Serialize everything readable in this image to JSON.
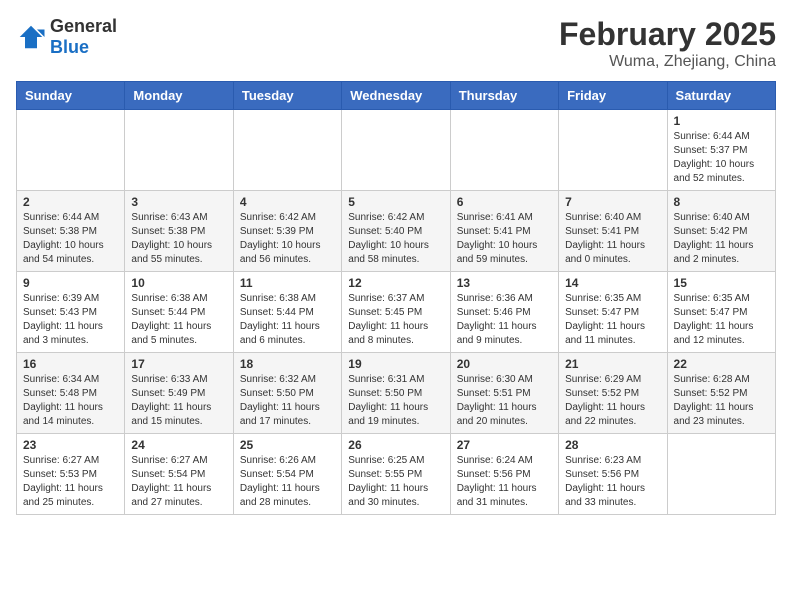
{
  "header": {
    "logo_general": "General",
    "logo_blue": "Blue",
    "title": "February 2025",
    "subtitle": "Wuma, Zhejiang, China"
  },
  "weekdays": [
    "Sunday",
    "Monday",
    "Tuesday",
    "Wednesday",
    "Thursday",
    "Friday",
    "Saturday"
  ],
  "weeks": [
    [
      {
        "day": "",
        "info": ""
      },
      {
        "day": "",
        "info": ""
      },
      {
        "day": "",
        "info": ""
      },
      {
        "day": "",
        "info": ""
      },
      {
        "day": "",
        "info": ""
      },
      {
        "day": "",
        "info": ""
      },
      {
        "day": "1",
        "info": "Sunrise: 6:44 AM\nSunset: 5:37 PM\nDaylight: 10 hours\nand 52 minutes."
      }
    ],
    [
      {
        "day": "2",
        "info": "Sunrise: 6:44 AM\nSunset: 5:38 PM\nDaylight: 10 hours\nand 54 minutes."
      },
      {
        "day": "3",
        "info": "Sunrise: 6:43 AM\nSunset: 5:38 PM\nDaylight: 10 hours\nand 55 minutes."
      },
      {
        "day": "4",
        "info": "Sunrise: 6:42 AM\nSunset: 5:39 PM\nDaylight: 10 hours\nand 56 minutes."
      },
      {
        "day": "5",
        "info": "Sunrise: 6:42 AM\nSunset: 5:40 PM\nDaylight: 10 hours\nand 58 minutes."
      },
      {
        "day": "6",
        "info": "Sunrise: 6:41 AM\nSunset: 5:41 PM\nDaylight: 10 hours\nand 59 minutes."
      },
      {
        "day": "7",
        "info": "Sunrise: 6:40 AM\nSunset: 5:41 PM\nDaylight: 11 hours\nand 0 minutes."
      },
      {
        "day": "8",
        "info": "Sunrise: 6:40 AM\nSunset: 5:42 PM\nDaylight: 11 hours\nand 2 minutes."
      }
    ],
    [
      {
        "day": "9",
        "info": "Sunrise: 6:39 AM\nSunset: 5:43 PM\nDaylight: 11 hours\nand 3 minutes."
      },
      {
        "day": "10",
        "info": "Sunrise: 6:38 AM\nSunset: 5:44 PM\nDaylight: 11 hours\nand 5 minutes."
      },
      {
        "day": "11",
        "info": "Sunrise: 6:38 AM\nSunset: 5:44 PM\nDaylight: 11 hours\nand 6 minutes."
      },
      {
        "day": "12",
        "info": "Sunrise: 6:37 AM\nSunset: 5:45 PM\nDaylight: 11 hours\nand 8 minutes."
      },
      {
        "day": "13",
        "info": "Sunrise: 6:36 AM\nSunset: 5:46 PM\nDaylight: 11 hours\nand 9 minutes."
      },
      {
        "day": "14",
        "info": "Sunrise: 6:35 AM\nSunset: 5:47 PM\nDaylight: 11 hours\nand 11 minutes."
      },
      {
        "day": "15",
        "info": "Sunrise: 6:35 AM\nSunset: 5:47 PM\nDaylight: 11 hours\nand 12 minutes."
      }
    ],
    [
      {
        "day": "16",
        "info": "Sunrise: 6:34 AM\nSunset: 5:48 PM\nDaylight: 11 hours\nand 14 minutes."
      },
      {
        "day": "17",
        "info": "Sunrise: 6:33 AM\nSunset: 5:49 PM\nDaylight: 11 hours\nand 15 minutes."
      },
      {
        "day": "18",
        "info": "Sunrise: 6:32 AM\nSunset: 5:50 PM\nDaylight: 11 hours\nand 17 minutes."
      },
      {
        "day": "19",
        "info": "Sunrise: 6:31 AM\nSunset: 5:50 PM\nDaylight: 11 hours\nand 19 minutes."
      },
      {
        "day": "20",
        "info": "Sunrise: 6:30 AM\nSunset: 5:51 PM\nDaylight: 11 hours\nand 20 minutes."
      },
      {
        "day": "21",
        "info": "Sunrise: 6:29 AM\nSunset: 5:52 PM\nDaylight: 11 hours\nand 22 minutes."
      },
      {
        "day": "22",
        "info": "Sunrise: 6:28 AM\nSunset: 5:52 PM\nDaylight: 11 hours\nand 23 minutes."
      }
    ],
    [
      {
        "day": "23",
        "info": "Sunrise: 6:27 AM\nSunset: 5:53 PM\nDaylight: 11 hours\nand 25 minutes."
      },
      {
        "day": "24",
        "info": "Sunrise: 6:27 AM\nSunset: 5:54 PM\nDaylight: 11 hours\nand 27 minutes."
      },
      {
        "day": "25",
        "info": "Sunrise: 6:26 AM\nSunset: 5:54 PM\nDaylight: 11 hours\nand 28 minutes."
      },
      {
        "day": "26",
        "info": "Sunrise: 6:25 AM\nSunset: 5:55 PM\nDaylight: 11 hours\nand 30 minutes."
      },
      {
        "day": "27",
        "info": "Sunrise: 6:24 AM\nSunset: 5:56 PM\nDaylight: 11 hours\nand 31 minutes."
      },
      {
        "day": "28",
        "info": "Sunrise: 6:23 AM\nSunset: 5:56 PM\nDaylight: 11 hours\nand 33 minutes."
      },
      {
        "day": "",
        "info": ""
      }
    ]
  ]
}
